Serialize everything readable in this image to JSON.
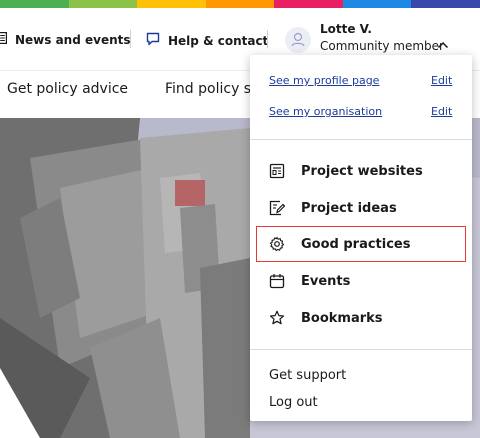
{
  "colors": {
    "strip": [
      "#4caf50",
      "#8bc34a",
      "#ffc107",
      "#ff9800",
      "#e91e63",
      "#1e88e5",
      "#3949ab"
    ],
    "accent_link": "#1c3c9c",
    "highlight_outline": "#e53935"
  },
  "header": {
    "news_label": "News and events",
    "news_icon": "newspaper-icon",
    "help_label": "Help & contact",
    "help_icon": "speech-bubble-icon",
    "user_name": "Lotte V.",
    "user_role": "Community member",
    "user_menu_icon": "chevron-up-icon"
  },
  "nav": {
    "items": [
      "Get policy advice",
      "Find policy sol"
    ]
  },
  "dropdown": {
    "profile_link": "See my profile page",
    "profile_edit": "Edit",
    "org_link": "See my organisation",
    "org_edit": "Edit",
    "menu": [
      {
        "label": "Project websites",
        "icon": "website-icon"
      },
      {
        "label": "Project ideas",
        "icon": "edit-note-icon"
      },
      {
        "label": "Good practices",
        "icon": "gear-icon"
      },
      {
        "label": "Events",
        "icon": "calendar-icon"
      },
      {
        "label": "Bookmarks",
        "icon": "star-icon"
      }
    ],
    "support_label": "Get support",
    "logout_label": "Log out"
  }
}
